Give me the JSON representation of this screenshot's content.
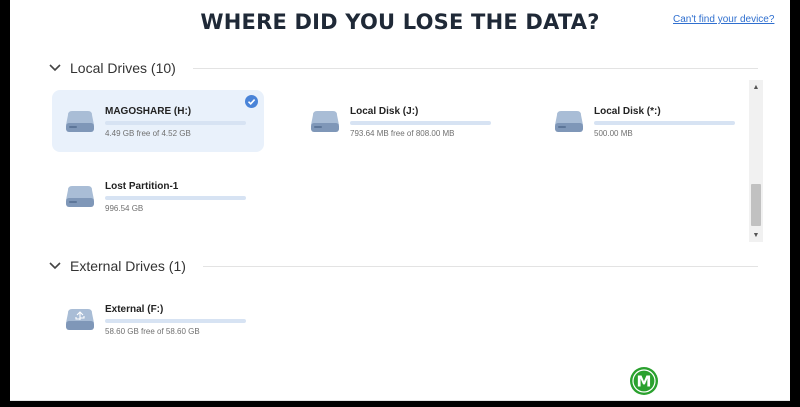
{
  "header": {
    "title": "WHERE DID YOU LOSE THE DATA?",
    "help_link": "Can't find your device?"
  },
  "colors": {
    "accent": "#4a84d8",
    "bar_track": "#d7e3f3",
    "bar_warning": "#f4c766",
    "selected_bg": "#e9f1fb",
    "logo_green": "#2aa12e"
  },
  "local_drives": {
    "heading": "Local Drives (10)",
    "items": [
      {
        "name": "MAGOSHARE (H:)",
        "size_text": "4.49 GB free of 4.52 GB",
        "used_fraction": 0.01,
        "bar_color": "#4a84d8",
        "selected": true,
        "icon": "hard-drive-icon"
      },
      {
        "name": "Local Disk (J:)",
        "size_text": "793.64 MB free of 808.00 MB",
        "used_fraction": 0.02,
        "bar_color": "#4a84d8",
        "selected": false,
        "icon": "hard-drive-icon"
      },
      {
        "name": "Local Disk (*:)",
        "size_text": "500.00 MB",
        "used_fraction": 1.0,
        "bar_color": "#f4c766",
        "selected": false,
        "icon": "hard-drive-icon"
      },
      {
        "name": "Lost Partition-1",
        "size_text": "996.54 GB",
        "used_fraction": 1.0,
        "bar_color": "#f4c766",
        "selected": false,
        "icon": "hard-drive-icon"
      }
    ]
  },
  "external_drives": {
    "heading": "External Drives (1)",
    "items": [
      {
        "name": "External (F:)",
        "size_text": "58.60 GB free of 58.60 GB",
        "used_fraction": 0.01,
        "bar_color": "#4a84d8",
        "selected": false,
        "icon": "usb-drive-icon"
      }
    ]
  },
  "scrollbar": {
    "up": "▲",
    "down": "▼",
    "position_fraction": 0.75
  },
  "logo": {
    "icon": "watermark-logo",
    "letter": "M"
  }
}
